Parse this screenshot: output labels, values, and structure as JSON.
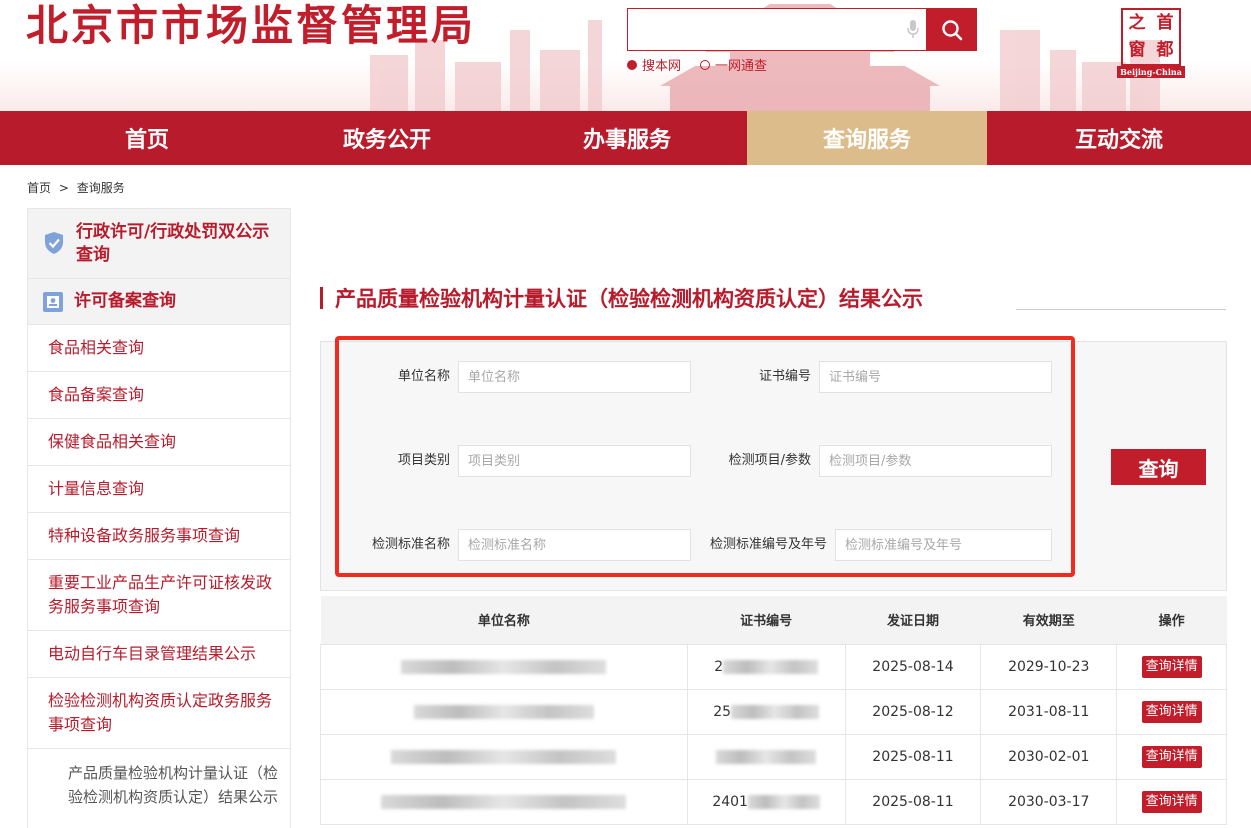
{
  "header": {
    "site_title": "北京市市场监督管理局",
    "search": {
      "placeholder": "",
      "scope_options": [
        "搜本网",
        "一网通查"
      ],
      "scope_selected": "搜本网"
    },
    "logo": {
      "chars": [
        "首",
        "都",
        "之",
        "窗"
      ],
      "caption": "Beijing-China"
    }
  },
  "nav": {
    "items": [
      "首页",
      "政务公开",
      "办事服务",
      "查询服务",
      "互动交流"
    ],
    "active": "查询服务"
  },
  "breadcrumb": {
    "home": "首页",
    "separator": ">",
    "current": "查询服务"
  },
  "sidebar": {
    "section1": {
      "icon": "shield-check-icon",
      "label": "行政许可/行政处罚双公示查询"
    },
    "section2": {
      "icon": "permit-document-icon",
      "label": "许可备案查询"
    },
    "items": [
      "食品相关查询",
      "食品备案查询",
      "保健食品相关查询",
      "计量信息查询",
      "特种设备政务服务事项查询",
      "重要工业产品生产许可证核发政务服务事项查询",
      "电动自行车目录管理结果公示",
      "检验检测机构资质认定政务服务事项查询"
    ],
    "sub_item": "产品质量检验机构计量认证（检验检测机构资质认定）结果公示"
  },
  "main": {
    "title": "产品质量检验机构计量认证（检验检测机构资质认定）结果公示",
    "form": {
      "unit_name": {
        "label": "单位名称",
        "placeholder": "单位名称"
      },
      "cert_no": {
        "label": "证书编号",
        "placeholder": "证书编号"
      },
      "project_type": {
        "label": "项目类别",
        "placeholder": "项目类别"
      },
      "test_item": {
        "label": "检测项目/参数",
        "placeholder": "检测项目/参数"
      },
      "std_name": {
        "label": "检测标准名称",
        "placeholder": "检测标准名称"
      },
      "std_no": {
        "label": "检测标准编号及年号",
        "placeholder": "检测标准编号及年号"
      },
      "submit": "查询"
    },
    "table": {
      "columns": [
        "单位名称",
        "证书编号",
        "发证日期",
        "有效期至",
        "操作"
      ],
      "rows": [
        {
          "unit_name": "",
          "cert_no": "2",
          "issue_date": "2025-08-14",
          "valid_until": "2029-10-23",
          "action": "查询详情"
        },
        {
          "unit_name": "",
          "cert_no": "25",
          "issue_date": "2025-08-12",
          "valid_until": "2031-08-11",
          "action": "查询详情"
        },
        {
          "unit_name": "",
          "cert_no": "",
          "issue_date": "2025-08-11",
          "valid_until": "2030-02-01",
          "action": "查询详情"
        },
        {
          "unit_name": "",
          "cert_no": "2401",
          "issue_date": "2025-08-11",
          "valid_until": "2030-03-17",
          "action": "查询详情"
        }
      ]
    }
  },
  "colors": {
    "brand_red": "#b81c2c",
    "nav_active": "#dcbc8a",
    "highlight_box": "#f02b20"
  }
}
